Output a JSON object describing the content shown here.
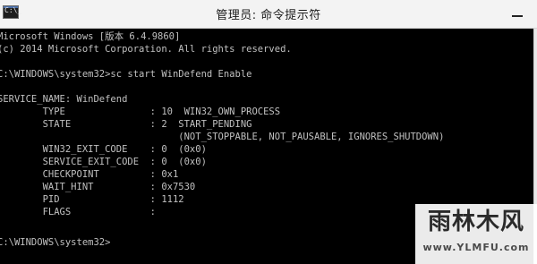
{
  "window": {
    "title": "管理员: 命令提示符",
    "icon": "cmd-icon",
    "icon_glyph": "C:\\_"
  },
  "console": {
    "lines": [
      "Microsoft Windows [版本 6.4.9860]",
      "(c) 2014 Microsoft Corporation. All rights reserved.",
      "",
      "C:\\WINDOWS\\system32>sc start WinDefend Enable",
      "",
      "SERVICE_NAME: WinDefend",
      "        TYPE               : 10  WIN32_OWN_PROCESS",
      "        STATE              : 2  START_PENDING",
      "                                (NOT_STOPPABLE, NOT_PAUSABLE, IGNORES_SHUTDOWN)",
      "        WIN32_EXIT_CODE    : 0  (0x0)",
      "        SERVICE_EXIT_CODE  : 0  (0x0)",
      "        CHECKPOINT         : 0x1",
      "        WAIT_HINT          : 0x7530",
      "        PID                : 1112",
      "        FLAGS              :",
      "",
      "C:\\WINDOWS\\system32>"
    ]
  },
  "watermark": {
    "main": "雨林木风",
    "url": "www.YLMFU.com"
  },
  "colors": {
    "console_bg": "#000000",
    "console_text": "#c0c0c0",
    "titlebar_bg": "#f3f3f3"
  }
}
